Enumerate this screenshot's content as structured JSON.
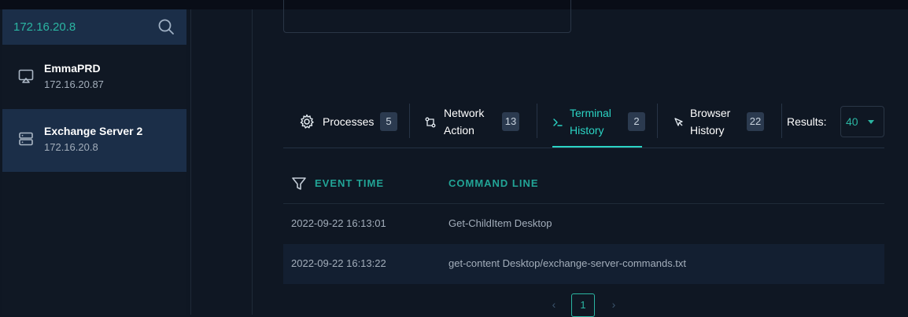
{
  "search": {
    "value": "172.16.20.8"
  },
  "devices": [
    {
      "name": "EmmaPRD",
      "ip": "172.16.20.87",
      "icon": "cast-icon",
      "selected": false
    },
    {
      "name": "Exchange Server 2",
      "ip": "172.16.20.8",
      "icon": "server-icon",
      "selected": true
    }
  ],
  "tabs": [
    {
      "label": "Processes",
      "count": "5",
      "icon": "gear-icon"
    },
    {
      "label_line1": "Network",
      "label_line2": "Action",
      "count": "13",
      "icon": "network-icon"
    },
    {
      "label_line1": "Terminal",
      "label_line2": "History",
      "count": "2",
      "icon": "terminal-icon",
      "active": true
    },
    {
      "label_line1": "Browser",
      "label_line2": "History",
      "count": "22",
      "icon": "cursor-icon"
    }
  ],
  "results": {
    "label": "Results:",
    "value": "40"
  },
  "table": {
    "columns": [
      "EVENT TIME",
      "COMMAND LINE"
    ],
    "rows": [
      [
        "2022-09-22 16:13:01",
        "Get-ChildItem Desktop"
      ],
      [
        "2022-09-22 16:13:22",
        "get-content Desktop/exchange-server-commands.txt"
      ]
    ]
  },
  "pagination": {
    "prev": "‹",
    "current": "1",
    "next": "›"
  },
  "colors": {
    "accent": "#2bd4c4",
    "sidebar_active": "#1b2e48",
    "background": "#0f1723"
  }
}
